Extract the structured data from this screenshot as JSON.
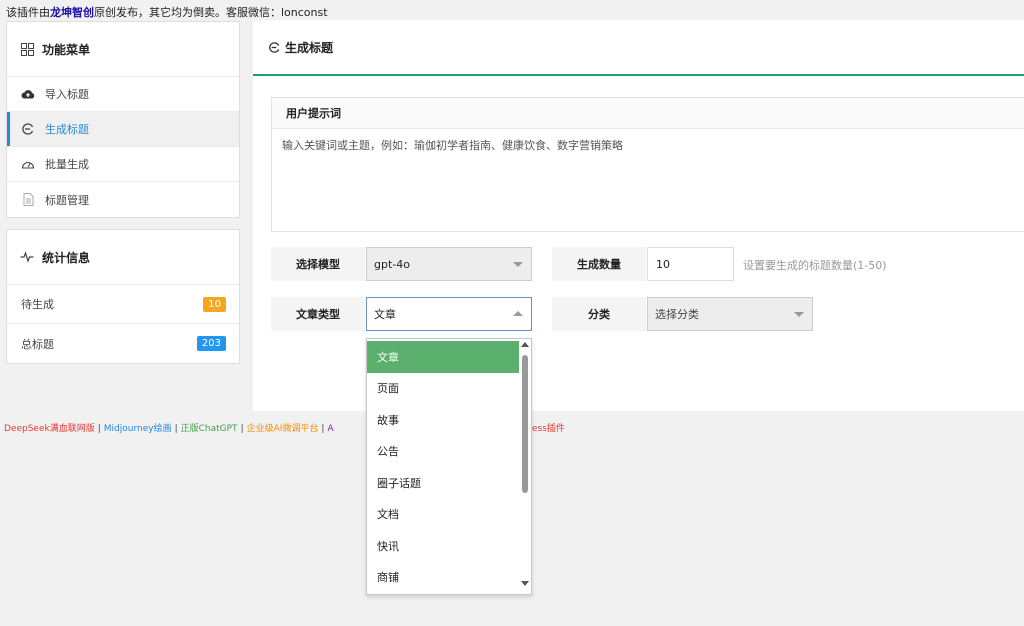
{
  "notice": {
    "prefix": "该插件由",
    "brand": "龙坤智创",
    "suffix": "原创发布，其它均为倒卖。客服微信：lonconst"
  },
  "sidebar": {
    "menu_title": "功能菜单",
    "items": [
      {
        "label": "导入标题",
        "icon": "cloud-upload-icon"
      },
      {
        "label": "生成标题",
        "icon": "refresh-icon"
      },
      {
        "label": "批量生成",
        "icon": "gauge-icon"
      },
      {
        "label": "标题管理",
        "icon": "document-icon"
      }
    ],
    "stats_title": "统计信息",
    "stats": [
      {
        "label": "待生成",
        "value": "10",
        "color": "#f5a623"
      },
      {
        "label": "总标题",
        "value": "203",
        "color": "#2196f3"
      }
    ]
  },
  "main": {
    "title": "生成标题",
    "prompt_label": "用户提示词",
    "prompt_placeholder": "输入关键词或主题，例如：瑜伽初学者指南、健康饮食、数字营销策略",
    "model_label": "选择模型",
    "model_value": "gpt-4o",
    "count_label": "生成数量",
    "count_value": "10",
    "count_hint": "设置要生成的标题数量(1-50)",
    "type_label": "文章类型",
    "type_value": "文章",
    "category_label": "分类",
    "category_value": "选择分类"
  },
  "dropdown": {
    "options": [
      "文章",
      "页面",
      "故事",
      "公告",
      "圈子话题",
      "文档",
      "快讯",
      "商铺"
    ],
    "selected": "文章"
  },
  "footer_links": [
    {
      "text": "DeepSeek满血联网版",
      "color": "#e53935"
    },
    {
      "text": "Midjourney绘画",
      "color": "#1e88e5"
    },
    {
      "text": "正版ChatGPT",
      "color": "#43a047"
    },
    {
      "text": "企业级AI微调平台",
      "color": "#fb8c00"
    },
    {
      "text": "A",
      "color": "#8e24aa"
    },
    {
      "text": "ess插件",
      "color": "#e53935"
    }
  ],
  "colors": {
    "accent": "#2a8ad4",
    "header_underline": "#1c9a7a",
    "selected_option": "#5bb06e"
  }
}
